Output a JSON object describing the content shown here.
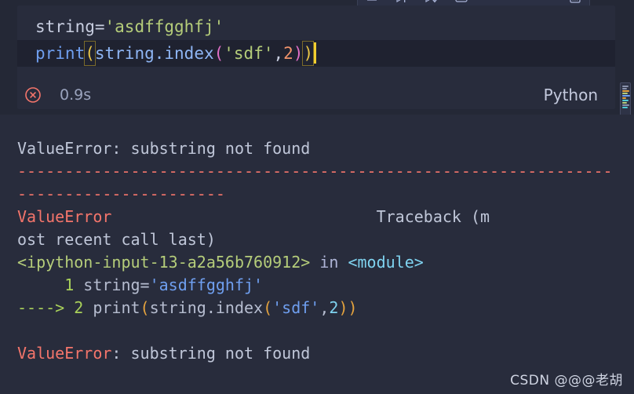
{
  "toolbar": {
    "buttons": [
      {
        "name": "execute-cell-icon",
        "label": "Execute Cell"
      },
      {
        "name": "execute-above-cells-icon",
        "label": "Execute Above Cells"
      },
      {
        "name": "execute-cell-and-below-icon",
        "label": "Execute Cell and Below"
      },
      {
        "name": "clear-outputs-icon",
        "label": "Clear Outputs"
      },
      {
        "name": "more-actions-icon",
        "label": "More Actions"
      }
    ]
  },
  "editor": {
    "line1": {
      "name": "string=",
      "string_literal": "'asdffgghfj'"
    },
    "line2": {
      "print": "print",
      "open_paren_outer": "(",
      "object": "string",
      "dot": ".",
      "method": "index",
      "open_paren_inner": "(",
      "arg_string": "'sdf'",
      "comma": ",",
      "arg_num": "2",
      "close_paren_inner": ")",
      "close_paren_outer": ")"
    }
  },
  "status": {
    "badge_icon": "error-circle-x-icon",
    "elapsed": "0.9s",
    "language": "Python"
  },
  "output": {
    "summary": "ValueError: substring not found",
    "separator_line1": "---------------------------------------------------------------",
    "separator_line2": "----------------------",
    "traceback_header": {
      "error_name": "ValueError",
      "gap": "                            ",
      "label_part1": "Traceback (m",
      "label_part2": "ost recent call last)"
    },
    "frame": {
      "location": "<ipython-input-13-a2a56b760912>",
      "in_keyword": " in ",
      "scope": "<module>"
    },
    "source": [
      {
        "arrow": "     ",
        "lineno": "1",
        "code_plain": " string=",
        "code_string": "'asdffgghfj'"
      },
      {
        "arrow": "----> ",
        "lineno": "2",
        "code_prefix": " print",
        "paren_open_1": "(",
        "code_mid": "string.index",
        "paren_open_2": "(",
        "code_string": "'sdf'",
        "comma": ",",
        "num": "2",
        "paren_close": "))"
      }
    ],
    "final_error_name": "ValueError",
    "final_error_message": ": substring not found"
  },
  "watermark": {
    "text": "CSDN @@@老胡"
  },
  "colors": {
    "background": "#242836",
    "cell_background": "#282c3c",
    "active_line": "#1f2230",
    "error_red": "#f4756b",
    "string_green": "#b5cd7a",
    "function_blue": "#6f9ff0",
    "number_orange": "#f0936b",
    "bracket_yellow": "#e8c547",
    "bracket_magenta": "#e06fc7",
    "bracket_cyan": "#4ec9d6",
    "caret_yellow": "#f2cf30"
  }
}
